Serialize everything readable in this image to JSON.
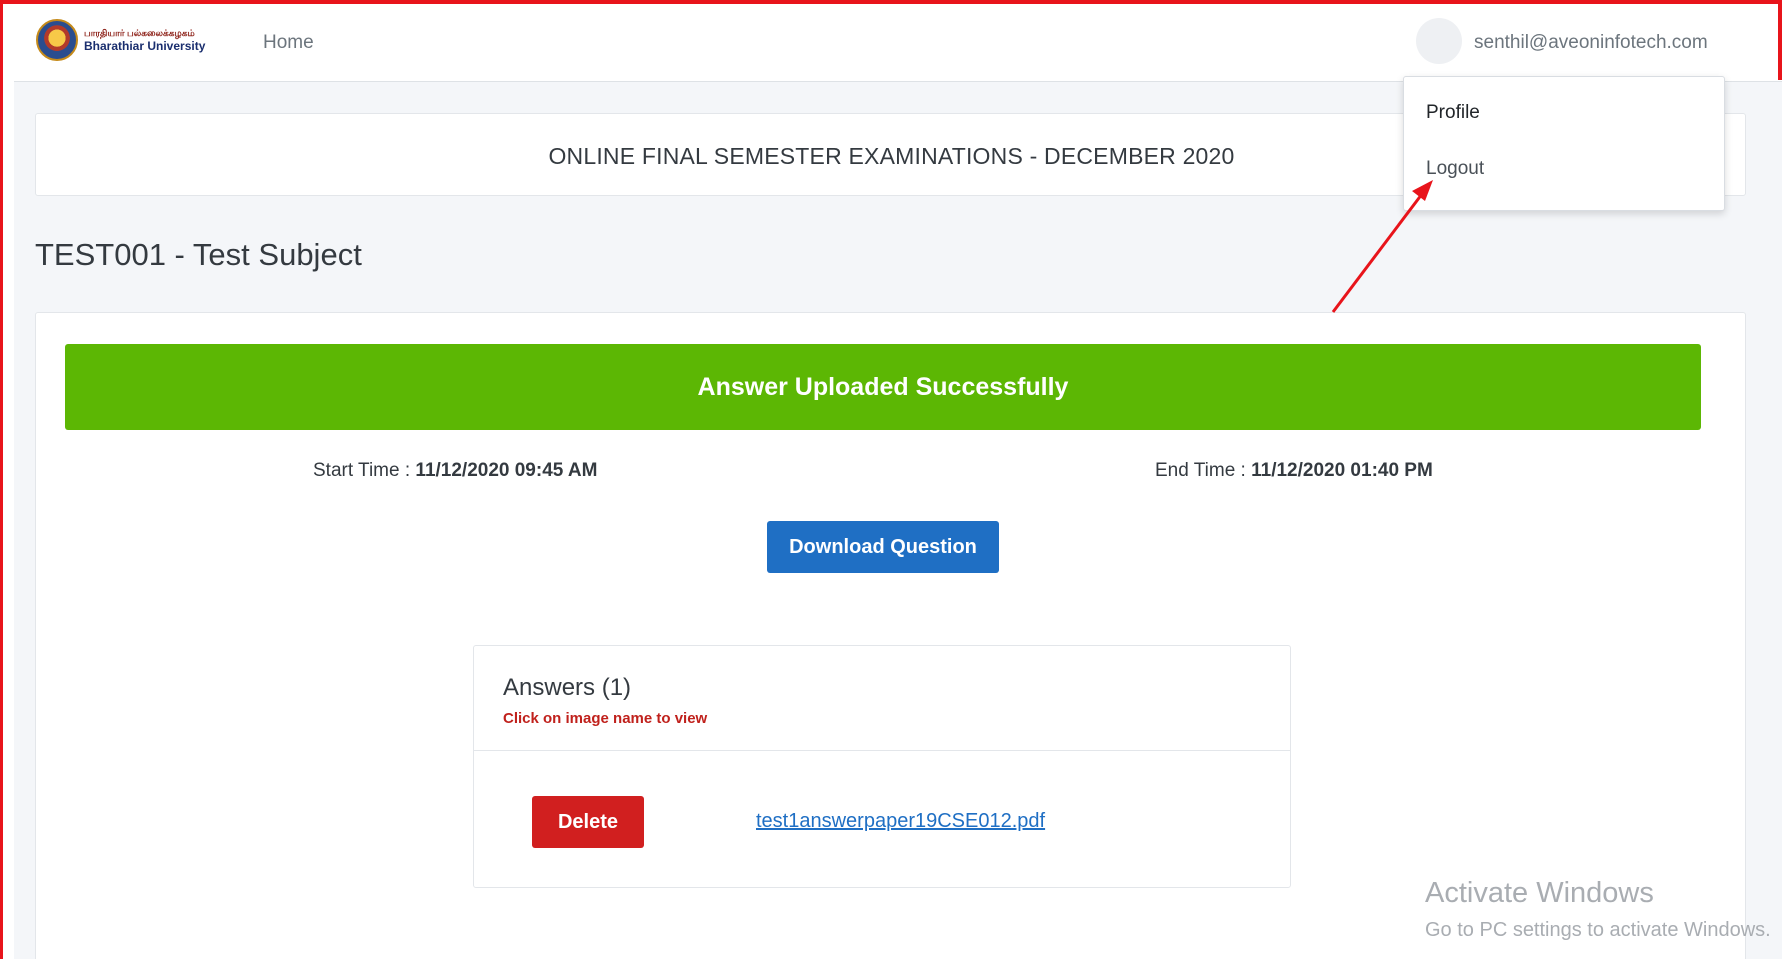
{
  "navbar": {
    "logo": {
      "tamil_text": "பாரதியார் பல்கலைக்கழகம்",
      "name": "Bharathiar University"
    },
    "home_link": "Home",
    "user_email": "senthil@aveoninfotech.com"
  },
  "user_menu": {
    "items": [
      {
        "label": "Profile"
      },
      {
        "label": "Logout"
      }
    ]
  },
  "exam": {
    "title": "ONLINE FINAL SEMESTER EXAMINATIONS - DECEMBER 2020",
    "subject": "TEST001 - Test Subject",
    "status_message": "Answer Uploaded Successfully",
    "start_label": "Start Time : ",
    "start_value": "11/12/2020 09:45 AM",
    "end_label": "End Time : ",
    "end_value": "11/12/2020 01:40 PM",
    "download_label": "Download Question"
  },
  "answers": {
    "title": "Answers (1)",
    "hint": "Click on image name to view",
    "files": [
      {
        "delete_label": "Delete",
        "filename": "test1answerpaper19CSE012.pdf"
      }
    ]
  },
  "watermark": {
    "title": "Activate Windows",
    "subtitle": "Go to PC settings to activate Windows."
  },
  "colors": {
    "success": "#5cb704",
    "primary": "#1f6fc4",
    "danger": "#d11f1f",
    "annotation": "#e8141b"
  }
}
